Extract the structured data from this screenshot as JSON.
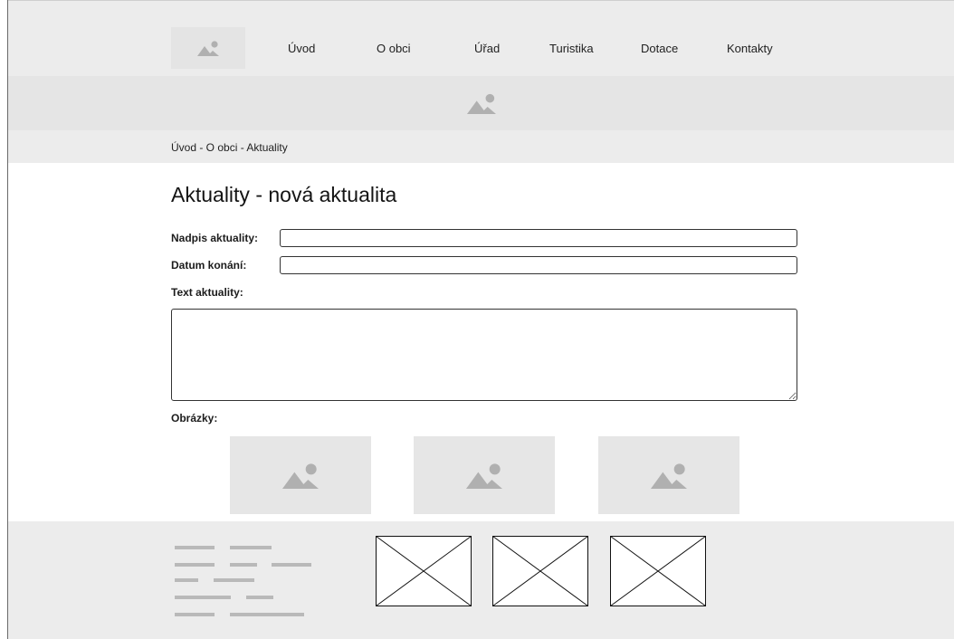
{
  "nav": {
    "logo_icon": "image-placeholder-icon",
    "items": [
      "Úvod",
      "O obci",
      "Úřad",
      "Turistika",
      "Dotace",
      "Kontakty"
    ]
  },
  "banner": {
    "icon": "image-placeholder-icon"
  },
  "breadcrumb": "Úvod - O obci - Aktuality",
  "page": {
    "title": "Aktuality - nová aktualita"
  },
  "form": {
    "headline_label": "Nadpis aktuality:",
    "headline_value": "",
    "date_label": "Datum konání:",
    "date_value": "",
    "text_label": "Text aktuality:",
    "text_value": "",
    "images_label": "Obrázky:"
  },
  "images": [
    "image-placeholder-icon",
    "image-placeholder-icon",
    "image-placeholder-icon"
  ],
  "footer": {
    "text_placeholder_icon": "text-lines-placeholder",
    "boxes": [
      "image-x-placeholder",
      "image-x-placeholder",
      "image-x-placeholder"
    ]
  },
  "colors": {
    "bar_bg": "#ececec",
    "banner_bg": "#e5e5e5",
    "placeholder_icon": "#b0b0b0"
  }
}
